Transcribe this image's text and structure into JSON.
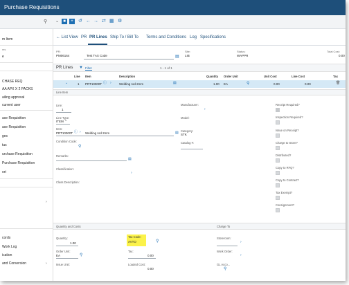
{
  "app": {
    "title": "Purchase Requisitions"
  },
  "toolbar": {
    "search_icon": "search-icon",
    "nav_icons": [
      "chevron-down-icon",
      "save-icon",
      "new-icon",
      "undo-icon",
      "arrow-left-icon",
      "arrow-right-icon",
      "refresh-icon",
      "grid-icon",
      "settings-icon"
    ]
  },
  "sidebar": {
    "items": [
      "m Item",
      "ms",
      "e",
      "CHASE REQ",
      "AA APX X 2 PACKS",
      "ailing approval",
      "current user",
      "ase Requisition",
      "ase Requisition",
      "ges",
      "tus",
      "urchase Requisition",
      "Purchase Requisition",
      "ort",
      "cords",
      "Work Log",
      "ication",
      "and Conversion"
    ]
  },
  "tabs": [
    "List View",
    "PR",
    "PR Lines",
    "Ship To / Bill To",
    "Terms and Conditions",
    "Log",
    "Specifications"
  ],
  "header": {
    "pr_label": "PR:",
    "pr_value": "PM06164",
    "desc_value": "Test TAX Code",
    "site_label": "Site:",
    "site_value": "LIB",
    "status_label": "Status:",
    "status_value": "WAPPR",
    "total_label": "Total Cost:",
    "total_value": "0.00"
  },
  "prlines": {
    "title": "PR Lines",
    "filter": "Filter",
    "pager": "1 - 1 of 1",
    "columns": [
      "Line",
      "Item",
      "Description",
      "Quantity",
      "Order Unit",
      "Unit Cost",
      "Line Cost",
      "Tax"
    ],
    "row": {
      "line": "1",
      "item": "PRT10000T",
      "description": "Welding rod 2mm",
      "quantity": "1.00",
      "order_unit": "EA",
      "unit_cost": "0.00",
      "line_cost": "0.00"
    }
  },
  "line_item": {
    "section": "Line Item",
    "line_label": "Line:",
    "line_value": "1",
    "line_type_label": "Line Type:",
    "line_type_value": "ITEM",
    "item_label": "Item:",
    "item_value": "PRT10000T",
    "item_desc": "Welding rod 2mm",
    "condition_label": "Condition Code:",
    "remarks_label": "Remarks:",
    "classification_label": "Classification:",
    "class_desc_label": "Class Description:",
    "manufacturer_label": "Manufacturer:",
    "model_label": "Model:",
    "category_label": "Category:",
    "category_value": "STK",
    "catalog_label": "Catalog #:",
    "right_checks": [
      "Receipt Required?",
      "Inspection Required?",
      "Issue on Receipt?",
      "Charge to Store?",
      "Distributed?",
      "Copy to RFQ?",
      "Copy to Contract?",
      "Tax Exempt?",
      "Consignment?"
    ]
  },
  "qty_costs": {
    "section": "Quantity and Costs",
    "quantity_label": "Quantity:",
    "quantity_value": "1.00",
    "order_unit_label": "Order Unit:",
    "order_unit_value": "EA",
    "issue_unit_label": "Issue Unit:",
    "tax_code_label": "Tax Code:",
    "tax_code_value": "AVTO",
    "tax_label": "Tax:",
    "tax_value": "0.00",
    "loaded_cost_label": "Loaded Cost:",
    "loaded_cost_value": "0.00"
  },
  "charge_to": {
    "section": "Charge To",
    "storeroom_label": "Storeroom:",
    "work_order_label": "Work Order:",
    "gl_label": "GL Acco..."
  }
}
